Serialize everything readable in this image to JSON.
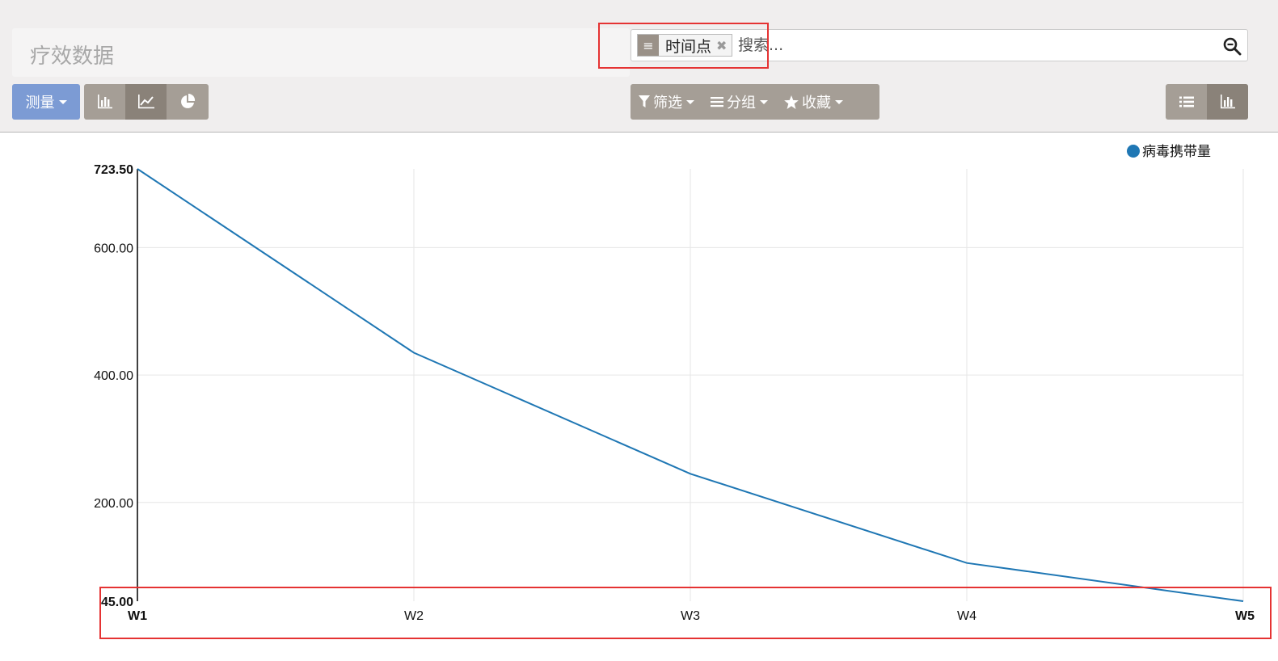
{
  "header": {
    "title": "疗效数据",
    "search": {
      "facet_label": "时间点",
      "placeholder": "搜索..."
    }
  },
  "toolbar": {
    "measure_label": "测量",
    "filter_label": "筛选",
    "group_label": "分组",
    "favorite_label": "收藏"
  },
  "colors": {
    "line": "#1f77b4",
    "highlight": "#e53333",
    "accent": "#7c9bd4"
  },
  "chart_data": {
    "type": "line",
    "categories": [
      "W1",
      "W2",
      "W3",
      "W4",
      "W5"
    ],
    "series": [
      {
        "name": "病毒携带量",
        "values": [
          723.5,
          435,
          245,
          105,
          45
        ]
      }
    ],
    "ylim": [
      45,
      723.5
    ],
    "yticks": [
      "723.50",
      "600.00",
      "400.00",
      "200.00",
      "45.00"
    ],
    "grid": true,
    "legend": "top-right"
  }
}
